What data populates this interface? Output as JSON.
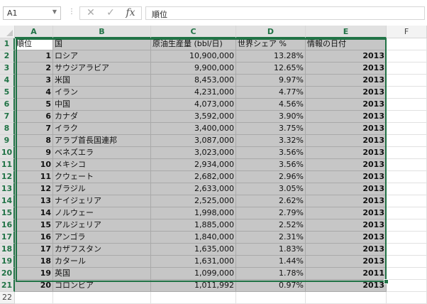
{
  "namebox": {
    "value": "A1"
  },
  "formula": {
    "value": "順位",
    "cancel_icon": "x-icon",
    "enter_icon": "check-icon",
    "fx_label": "fx"
  },
  "columns": [
    "A",
    "B",
    "C",
    "D",
    "E",
    "F"
  ],
  "headers": {
    "rank": "順位",
    "country": "国",
    "production": "原油生産量 (bbl/日)",
    "share": "世界シェア %",
    "date": "情報の日付"
  },
  "rows": [
    {
      "rank": "1",
      "country": "ロシア",
      "production": "10,900,000",
      "share": "13.28%",
      "date": "2013"
    },
    {
      "rank": "2",
      "country": "サウジアラビア",
      "production": "9,900,000",
      "share": "12.65%",
      "date": "2013"
    },
    {
      "rank": "3",
      "country": "米国",
      "production": "8,453,000",
      "share": "9.97%",
      "date": "2013"
    },
    {
      "rank": "4",
      "country": "イラン",
      "production": "4,231,000",
      "share": "4.77%",
      "date": "2013"
    },
    {
      "rank": "5",
      "country": "中国",
      "production": "4,073,000",
      "share": "4.56%",
      "date": "2013"
    },
    {
      "rank": "6",
      "country": "カナダ",
      "production": "3,592,000",
      "share": "3.90%",
      "date": "2013"
    },
    {
      "rank": "7",
      "country": "イラク",
      "production": "3,400,000",
      "share": "3.75%",
      "date": "2013"
    },
    {
      "rank": "8",
      "country": "アラブ首長国連邦",
      "production": "3,087,000",
      "share": "3.32%",
      "date": "2013"
    },
    {
      "rank": "9",
      "country": "ベネズエラ",
      "production": "3,023,000",
      "share": "3.56%",
      "date": "2013"
    },
    {
      "rank": "10",
      "country": "メキシコ",
      "production": "2,934,000",
      "share": "3.56%",
      "date": "2013"
    },
    {
      "rank": "11",
      "country": "クウェート",
      "production": "2,682,000",
      "share": "2.96%",
      "date": "2013"
    },
    {
      "rank": "12",
      "country": "ブラジル",
      "production": "2,633,000",
      "share": "3.05%",
      "date": "2013"
    },
    {
      "rank": "13",
      "country": "ナイジェリア",
      "production": "2,525,000",
      "share": "2.62%",
      "date": "2013"
    },
    {
      "rank": "14",
      "country": "ノルウェー",
      "production": "1,998,000",
      "share": "2.79%",
      "date": "2013"
    },
    {
      "rank": "15",
      "country": "アルジェリア",
      "production": "1,885,000",
      "share": "2.52%",
      "date": "2013"
    },
    {
      "rank": "16",
      "country": "アンゴラ",
      "production": "1,840,000",
      "share": "2.31%",
      "date": "2013"
    },
    {
      "rank": "17",
      "country": "カザフスタン",
      "production": "1,635,000",
      "share": "1.83%",
      "date": "2013"
    },
    {
      "rank": "18",
      "country": "カタール",
      "production": "1,631,000",
      "share": "1.44%",
      "date": "2013"
    },
    {
      "rank": "19",
      "country": "英国",
      "production": "1,099,000",
      "share": "1.78%",
      "date": "2011"
    },
    {
      "rank": "20",
      "country": "コロンビア",
      "production": "1,011,992",
      "share": "0.97%",
      "date": "2013"
    }
  ],
  "row_numbers": [
    "1",
    "2",
    "3",
    "4",
    "5",
    "6",
    "7",
    "8",
    "9",
    "10",
    "11",
    "12",
    "13",
    "14",
    "15",
    "16",
    "17",
    "18",
    "19",
    "20",
    "21",
    "22"
  ]
}
